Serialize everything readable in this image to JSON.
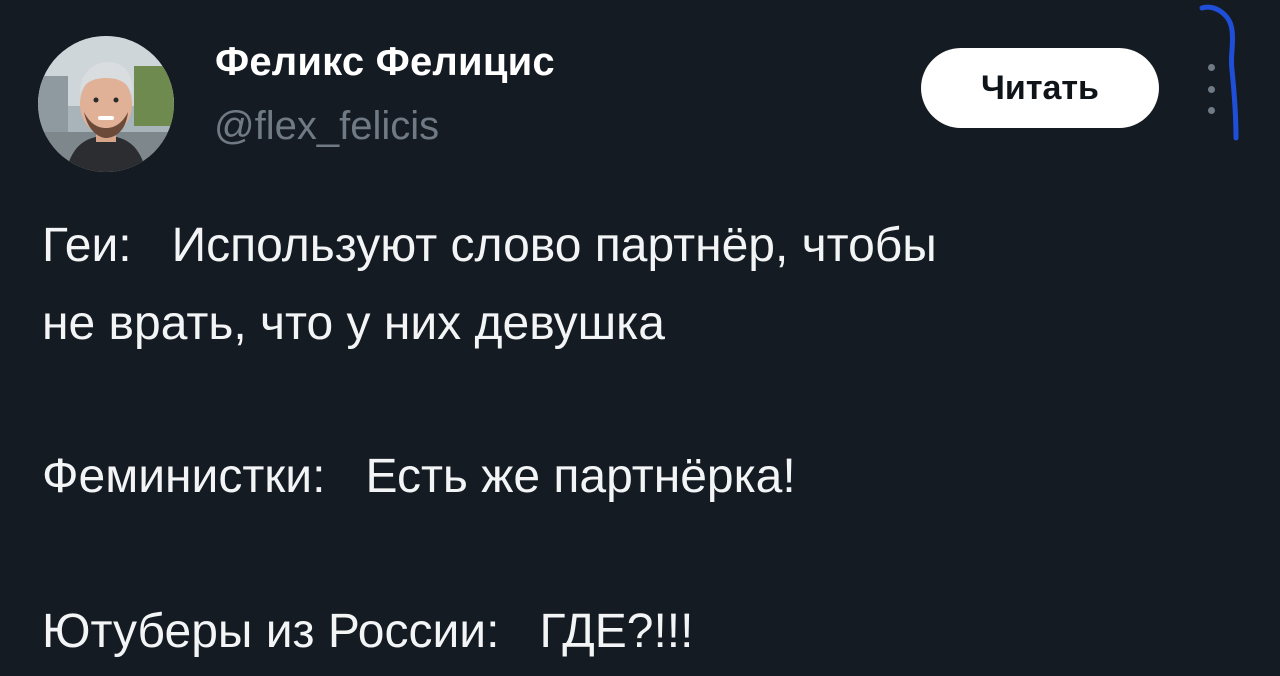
{
  "tweet": {
    "author": {
      "display_name": "Феликс Фелицис",
      "handle": "@flex_felicis",
      "avatar_icon": "user-avatar-photo"
    },
    "follow_button_label": "Читать",
    "more_icon": "vertical-ellipsis-icon",
    "lines": [
      "Геи:   Используют слово партнёр, чтобы",
      "не врать, что у них девушка",
      "Феминистки:   Есть же партнёрка!",
      "Ютуберы из России:   ГДЕ?!!!"
    ]
  },
  "colors": {
    "background": "#151b22",
    "text_primary": "#ffffff",
    "text_secondary": "#6f7a85",
    "button_bg": "#ffffff",
    "pen_annotation": "#1f4fd8"
  }
}
